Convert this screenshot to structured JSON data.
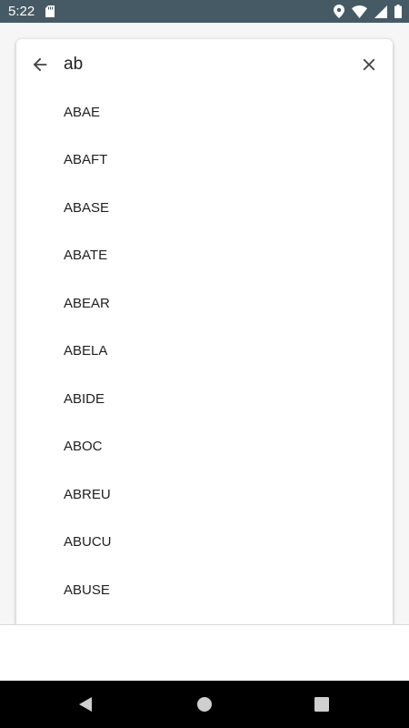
{
  "status_bar": {
    "time": "5:22",
    "icons": [
      "sd-card-icon",
      "location-icon",
      "wifi-icon",
      "signal-icon",
      "battery-icon"
    ]
  },
  "search": {
    "query": "ab",
    "back_icon": "arrow-back-icon",
    "clear_icon": "close-icon"
  },
  "suggestions": [
    "ABAE",
    "ABAFT",
    "ABASE",
    "ABATE",
    "ABEAR",
    "ABELA",
    "ABIDE",
    "ABOC",
    "ABREU",
    "ABUCU",
    "ABUSE"
  ],
  "nav_bar": {
    "icons": [
      "nav-back-icon",
      "nav-home-icon",
      "nav-recents-icon"
    ]
  },
  "colors": {
    "status_bar": "#455a64",
    "text": "#212121",
    "nav_bar": "#000000"
  }
}
